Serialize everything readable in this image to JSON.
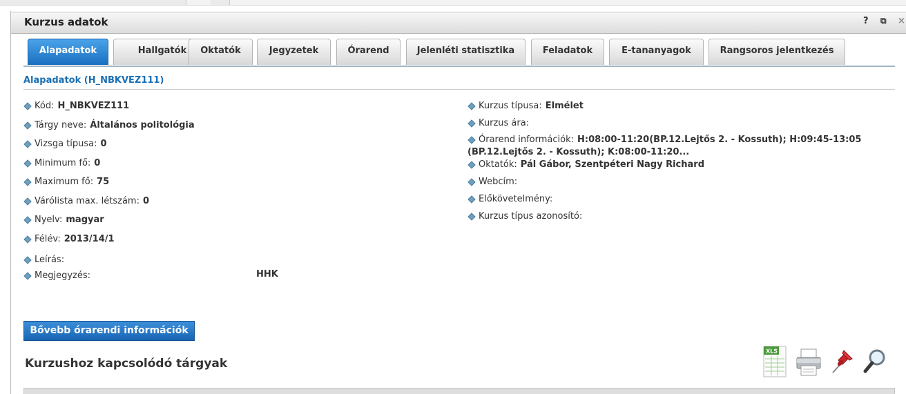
{
  "panel": {
    "title": "Kurzus adatok",
    "help_label": "?",
    "popout_label": "⧉",
    "close_label": "×"
  },
  "tabs": [
    {
      "label": "Alapadatok",
      "active": true
    },
    {
      "label": "Hallgatók"
    },
    {
      "label": "Oktatók"
    },
    {
      "label": "Jegyzetek"
    },
    {
      "label": "Órarend"
    },
    {
      "label": "Jelenléti statisztika"
    },
    {
      "label": "Feladatok"
    },
    {
      "label": "E-tananyagok"
    },
    {
      "label": "Rangsoros jelentkezés"
    }
  ],
  "section": {
    "title": "Alapadatok (H_NBKVEZ111)"
  },
  "left_fields": [
    {
      "label": "Kód:",
      "value": "H_NBKVEZ111"
    },
    {
      "label": "Tárgy neve:",
      "value": "Általános politológia"
    },
    {
      "label": "Vizsga típusa:",
      "value": "0"
    },
    {
      "label": "Minimum fő:",
      "value": "0"
    },
    {
      "label": "Maximum fő:",
      "value": "75"
    },
    {
      "label": "Várólista max. létszám:",
      "value": "0"
    },
    {
      "label": "Nyelv:",
      "value": "magyar"
    },
    {
      "label": "Félév:",
      "value": "2013/14/1"
    },
    {
      "label": "Leírás:",
      "value": ""
    },
    {
      "label": "Megjegyzés:",
      "value": "HHK"
    }
  ],
  "right_fields": [
    {
      "label": "Kurzus típusa:",
      "value": "Elmélet"
    },
    {
      "label": "Kurzus ára:",
      "value": ""
    },
    {
      "label": "Órarend információk:",
      "value": "H:08:00-11:20(BP.12.Lejtős 2. - Kossuth); H:09:45-13:05",
      "value_line2": "(BP.12.Lejtős 2. - Kossuth); K:08:00-11:20..."
    },
    {
      "label": "Oktatók:",
      "value": "Pál Gábor, Szentpéteri Nagy Richard"
    },
    {
      "label": "Webcím:",
      "value": ""
    },
    {
      "label": "Előkövetelmény:",
      "value": ""
    },
    {
      "label": "Kurzus típus azonosító:",
      "value": ""
    }
  ],
  "more_button": {
    "label": "Bővebb órarendi információk"
  },
  "related": {
    "title": "Kurzushoz kapcsolódó tárgyak"
  },
  "tools": {
    "xls_label": "XLS"
  },
  "colors": {
    "accent": "#1a6fb4",
    "active_tab": "#2a84d2",
    "bullet": "#6f9fbd"
  }
}
